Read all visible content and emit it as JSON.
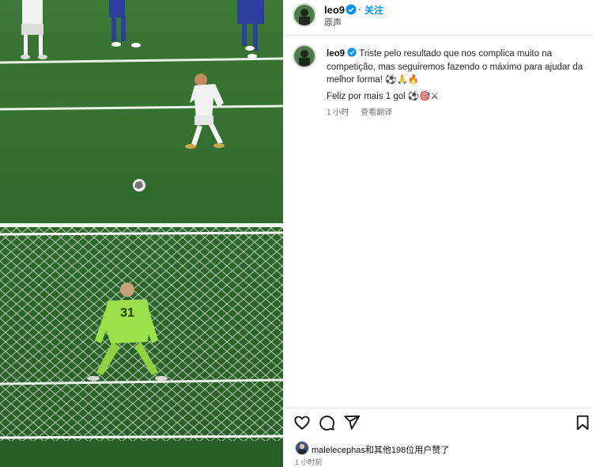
{
  "post": {
    "author": "leo9",
    "audio_label": "原声",
    "follow_label": "关注",
    "verified_icon": "verified-badge-icon"
  },
  "caption": {
    "username": "leo9",
    "text": "Triste pelo resultado que nos complica muito na competição, mas seguiremos fazendo o máximo para ajudar da melhor forma!",
    "emojis": "⚽🙏🔥"
  },
  "comment": {
    "text": "Feliz por mais 1 gol",
    "emojis": "⚽🎯⚔",
    "time": "1 小时",
    "translate_label": "查看翻译"
  },
  "actions": {
    "icons": [
      "heart-icon",
      "comment-icon",
      "share-icon",
      "bookmark-icon"
    ]
  },
  "likes": {
    "text": "malelecephas和其他198位用户赞了",
    "time": "1 小时前"
  },
  "media": {
    "goalkeeper_number": "31"
  },
  "colors": {
    "pitch": "#2e6b2e",
    "follow": "#0095f6",
    "verified": "#0095f6",
    "keeper_kit": "#9be04a"
  }
}
